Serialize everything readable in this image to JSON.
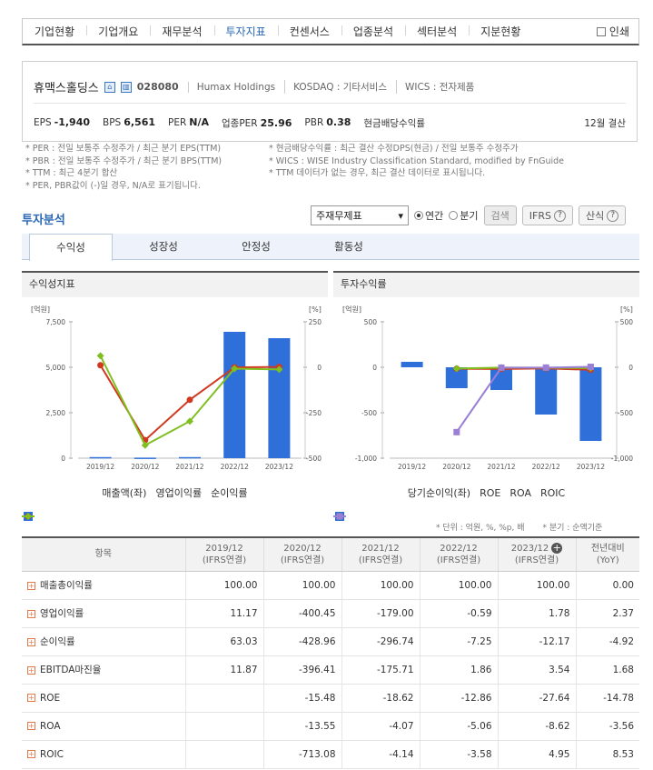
{
  "nav": {
    "tabs": [
      "기업현황",
      "기업개요",
      "재무분석",
      "투자지표",
      "컨센서스",
      "업종분석",
      "섹터분석",
      "지분현황"
    ],
    "active": 3,
    "print": "인쇄"
  },
  "company": {
    "name": "휴맥스홀딩스",
    "code": "028080",
    "eng": "Humax Holdings",
    "market": "KOSDAQ : 기타서비스",
    "wics": "WICS : 전자제품",
    "stats": [
      {
        "k": "EPS",
        "v": "-1,940"
      },
      {
        "k": "BPS",
        "v": "6,561"
      },
      {
        "k": "PER",
        "v": "N/A"
      },
      {
        "k": "업종PER",
        "v": "25.96"
      },
      {
        "k": "PBR",
        "v": "0.38"
      },
      {
        "k": "현금배당수익률",
        "v": ""
      }
    ],
    "settle": "12월 결산"
  },
  "notes_left": [
    "* PER : 전일 보통주 수정주가 / 최근 분기 EPS(TTM)",
    "* PBR : 전일 보통주 수정주가 / 최근 분기 BPS(TTM)",
    "* TTM : 최근 4분기 합산",
    "* PER, PBR값이 (-)일 경우, N/A로 표기됩니다."
  ],
  "notes_right": [
    "* 현금배당수익률 : 최근 결산 수정DPS(현금) / 전일 보통주 수정주가",
    "* WICS : WISE Industry Classification Standard, modified by FnGuide",
    "* TTM 데이터가 없는 경우, 최근 결산 데이터로 표시됩니다."
  ],
  "section": {
    "title": "투자분석",
    "select": "주재무제표",
    "radio_annual": "연간",
    "radio_quarter": "분기",
    "search": "검색",
    "ifrs": "IFRS",
    "formula": "산식"
  },
  "subtabs": [
    "수익성",
    "성장성",
    "안정성",
    "활동성"
  ],
  "colors": {
    "bar": "#2f6fd9",
    "red": "#d0391f",
    "green": "#7fbf1f",
    "purple": "#9b7fd6"
  },
  "chart_data": [
    {
      "type": "bar+line",
      "title": "수익성지표",
      "categories": [
        "2019/12",
        "2020/12",
        "2021/12",
        "2022/12",
        "2023/12"
      ],
      "left_unit": "[억원]",
      "right_unit": "[%]",
      "left_ticks": [
        "7,500",
        "5,000",
        "2,500",
        "0"
      ],
      "right_ticks": [
        "250",
        "0",
        "-250",
        "-500"
      ],
      "ylim_left": [
        0,
        7500
      ],
      "ylim_right": [
        -500,
        250
      ],
      "series": [
        {
          "name": "매출액(좌)",
          "axis": "left",
          "kind": "bar",
          "values": [
            60,
            30,
            60,
            6950,
            6600
          ]
        },
        {
          "name": "영업이익률",
          "axis": "right",
          "kind": "line",
          "values": [
            11.17,
            -400.45,
            -179.0,
            -0.59,
            1.78
          ]
        },
        {
          "name": "순이익률",
          "axis": "right",
          "kind": "line",
          "values": [
            63.03,
            -428.96,
            -296.74,
            -7.25,
            -12.17
          ]
        }
      ]
    },
    {
      "type": "bar+line",
      "title": "투자수익률",
      "categories": [
        "2019/12",
        "2020/12",
        "2021/12",
        "2022/12",
        "2023/12"
      ],
      "left_unit": "[억원]",
      "right_unit": "[%]",
      "left_ticks": [
        "500",
        "0",
        "-500",
        "-1,000"
      ],
      "right_ticks": [
        "500",
        "0",
        "-500",
        "-1,000"
      ],
      "ylim_left": [
        -1000,
        500
      ],
      "ylim_right": [
        -1000,
        500
      ],
      "series": [
        {
          "name": "당기순이익(좌)",
          "axis": "left",
          "kind": "bar",
          "values": [
            60,
            -230,
            -250,
            -520,
            -810
          ]
        },
        {
          "name": "ROE",
          "axis": "right",
          "kind": "line",
          "values": [
            null,
            -15.48,
            -18.62,
            -12.86,
            -27.64
          ]
        },
        {
          "name": "ROA",
          "axis": "right",
          "kind": "line",
          "values": [
            null,
            -13.55,
            -4.07,
            -5.06,
            -8.62
          ]
        },
        {
          "name": "ROIC",
          "axis": "right",
          "kind": "line",
          "values": [
            null,
            -713.08,
            -4.14,
            -3.58,
            4.95
          ]
        }
      ]
    }
  ],
  "unit_note": "* 단위 : 억원, %, %p, 배",
  "period_note": "* 분기 : 순액기준",
  "table": {
    "headers": [
      [
        "항목",
        ""
      ],
      [
        "2019/12",
        "(IFRS연결)"
      ],
      [
        "2020/12",
        "(IFRS연결)"
      ],
      [
        "2021/12",
        "(IFRS연결)"
      ],
      [
        "2022/12",
        "(IFRS연결)"
      ],
      [
        "2023/12",
        "(IFRS연결)"
      ],
      [
        "전년대비",
        "(YoY)"
      ]
    ],
    "rows": [
      [
        "매출총이익률",
        "100.00",
        "100.00",
        "100.00",
        "100.00",
        "100.00",
        "0.00"
      ],
      [
        "영업이익률",
        "11.17",
        "-400.45",
        "-179.00",
        "-0.59",
        "1.78",
        "2.37"
      ],
      [
        "순이익률",
        "63.03",
        "-428.96",
        "-296.74",
        "-7.25",
        "-12.17",
        "-4.92"
      ],
      [
        "EBITDA마진율",
        "11.87",
        "-396.41",
        "-175.71",
        "1.86",
        "3.54",
        "1.68"
      ],
      [
        "ROE",
        "",
        "-15.48",
        "-18.62",
        "-12.86",
        "-27.64",
        "-14.78"
      ],
      [
        "ROA",
        "",
        "-13.55",
        "-4.07",
        "-5.06",
        "-8.62",
        "-3.56"
      ],
      [
        "ROIC",
        "",
        "-713.08",
        "-4.14",
        "-3.58",
        "4.95",
        "8.53"
      ]
    ]
  }
}
